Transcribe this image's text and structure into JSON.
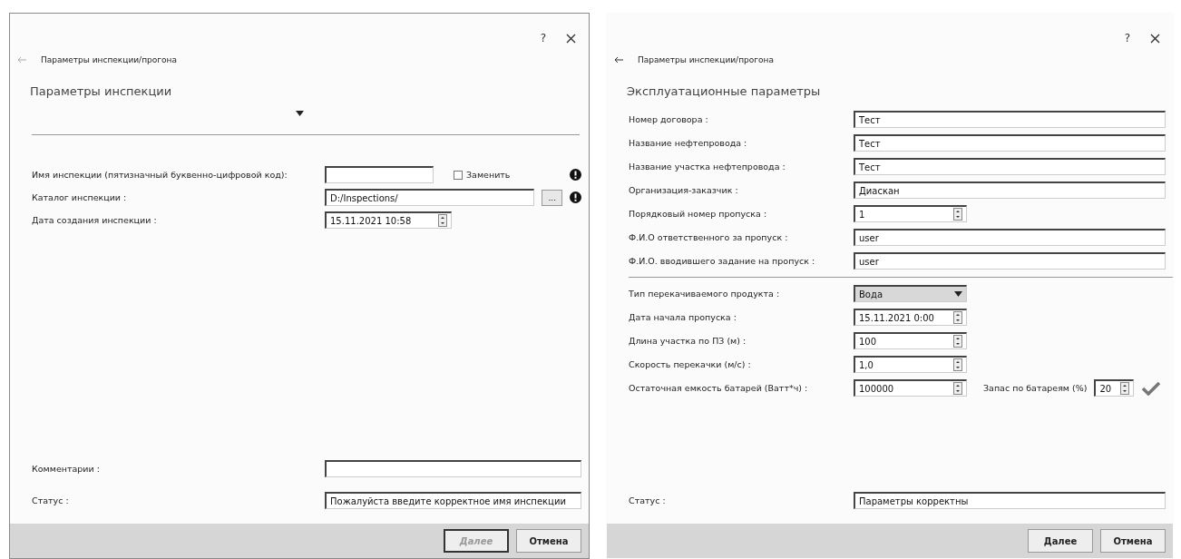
{
  "dialogs": [
    {
      "help": "?",
      "breadcrumb": "Параметры инспекции/прогона",
      "heading": "Параметры инспекции",
      "show_dropdown": true,
      "groups": [
        [
          {
            "kind": "text",
            "label": "Имя инспекции (пятизначный буквенно-цифровой код):",
            "checkbox": {
              "label": "Заменить",
              "checked": false
            },
            "warning": true
          },
          {
            "kind": "path",
            "label": "Каталог инспекции :",
            "value": "D:/Inspections/",
            "browse": "...",
            "warning": true
          },
          {
            "kind": "spin",
            "label": "Дата создания инспекции :",
            "value": "15.11.2021 10:58"
          }
        ]
      ],
      "bottom_rows": [
        {
          "kind": "text",
          "label": "Комментарии :"
        },
        {
          "kind": "text",
          "label": "Статус :",
          "value": "Пожалуйста введите корректное имя инспекции"
        }
      ],
      "buttons": [
        {
          "label": "Далее",
          "disabled": true
        },
        {
          "label": "Отмена",
          "disabled": false
        }
      ]
    },
    {
      "help": "?",
      "breadcrumb": "Параметры инспекции/прогона",
      "heading": "Эксплуатационные параметры",
      "show_dropdown": false,
      "groups": [
        [
          {
            "kind": "text",
            "label": "Номер договора :",
            "value": "Тест"
          },
          {
            "kind": "text",
            "label": "Название нефтепровода :",
            "value": "Тест"
          },
          {
            "kind": "text",
            "label": "Название участка нефтепровода :",
            "value": "Тест"
          },
          {
            "kind": "text",
            "label": "Организация-заказчик :",
            "value": "Диаскан"
          },
          {
            "kind": "spin",
            "label": "Порядковый номер пропуска :",
            "value": "1"
          },
          {
            "kind": "text",
            "label": "Ф.И.О ответственного за пропуск :",
            "value": "user"
          },
          {
            "kind": "text",
            "label": "Ф.И.О. вводившего задание на пропуск :",
            "value": "user"
          }
        ],
        [
          {
            "kind": "select",
            "label": "Тип перекачиваемого продукта :",
            "value": "Вода"
          },
          {
            "kind": "spin",
            "label": "Дата начала пропуска :",
            "value": "15.11.2021 0:00"
          },
          {
            "kind": "spin",
            "label": "Длина участка по ПЗ (м) :",
            "value": "100"
          },
          {
            "kind": "spin",
            "label": "Скорость перекачки (м/с) :",
            "value": "1,0"
          },
          {
            "kind": "spin",
            "label": "Остаточная емкость батарей (Ватт*ч) :",
            "value": "100000",
            "extra": {
              "label": "Запас по батареям (%)",
              "value": "20"
            },
            "valid": true
          }
        ]
      ],
      "bottom_rows": [
        {
          "kind": "text",
          "label": "Статус :",
          "value": "Параметры корректны"
        }
      ],
      "buttons": [
        {
          "label": "Далее",
          "disabled": false
        },
        {
          "label": "Отмена",
          "disabled": false
        }
      ]
    }
  ]
}
